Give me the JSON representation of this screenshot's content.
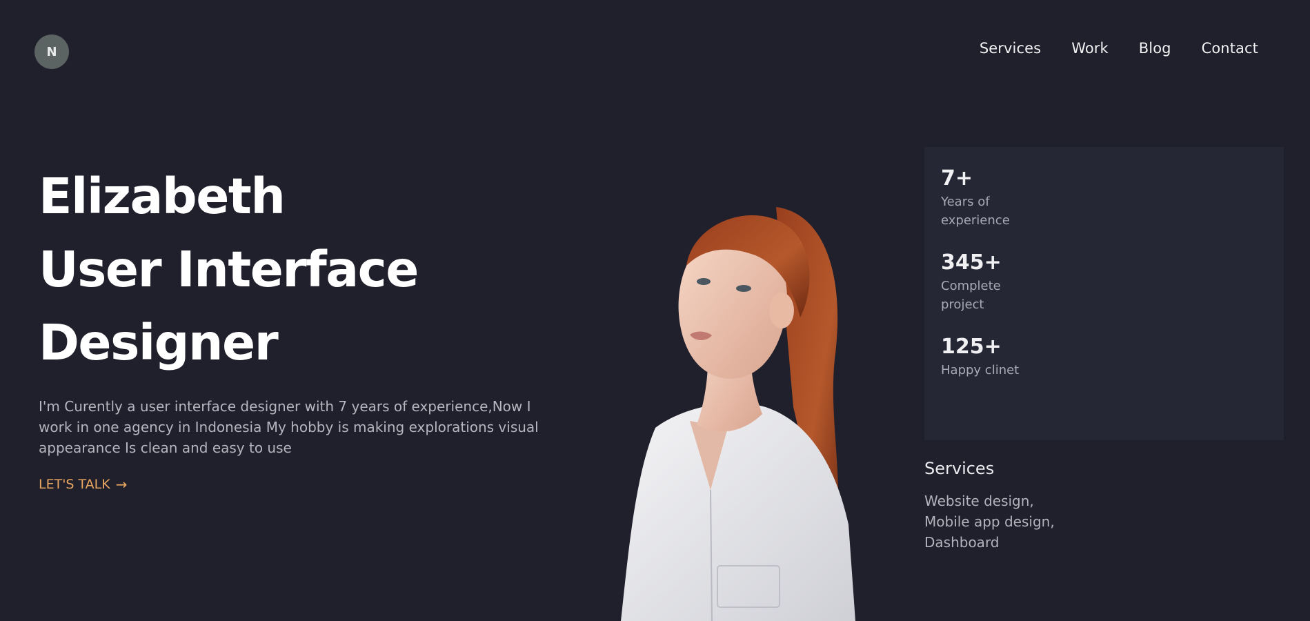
{
  "logo": {
    "initial": "N"
  },
  "nav": {
    "items": [
      {
        "label": "Services"
      },
      {
        "label": "Work"
      },
      {
        "label": "Blog"
      },
      {
        "label": "Contact"
      }
    ]
  },
  "hero": {
    "title_lines": [
      "Elizabeth",
      "User Interface",
      "Designer"
    ],
    "description": "I'm Curently a user interface designer with 7 years of experience,Now I work in one agency in Indonesia My hobby is making explorations visual appearance Is clean and easy to use",
    "cta_label": "LET'S TALK",
    "cta_arrow": "→"
  },
  "stats": [
    {
      "value": "7+",
      "label": "Years of experience"
    },
    {
      "value": "345+",
      "label": "Complete project"
    },
    {
      "value": "125+",
      "label": "Happy clinet"
    }
  ],
  "services": {
    "title": "Services",
    "items": [
      "Website design,",
      "Mobile app design,",
      "Dashboard"
    ]
  },
  "colors": {
    "background": "#201f2c",
    "panel": "#252834",
    "accent": "#e8a760",
    "logo_bg": "#5b6463"
  }
}
